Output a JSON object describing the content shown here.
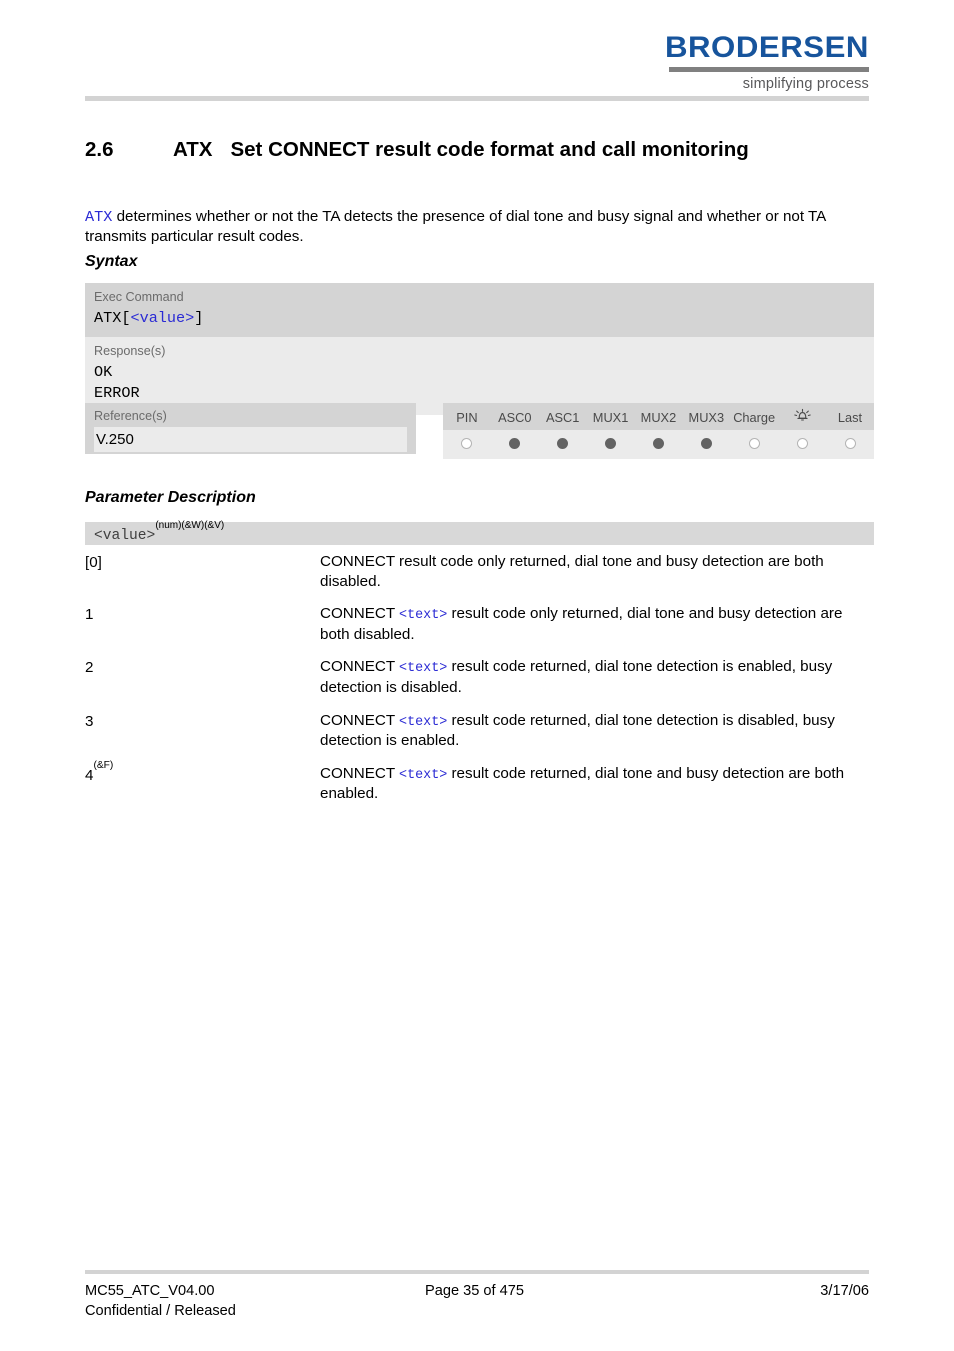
{
  "header": {
    "logo_wordmark": "BRODERSEN",
    "logo_tagline": "simplifying process"
  },
  "chapter": {
    "number": "2.6",
    "command": "ATX",
    "title": "Set CONNECT result code format and call monitoring"
  },
  "intro": {
    "command_code": "ATX",
    "text": " determines whether or not the TA detects the presence of dial tone and busy signal and whether or not TA transmits particular result codes."
  },
  "sections": {
    "syntax_heading": "Syntax",
    "parameter_heading": "Parameter Description"
  },
  "syntax": {
    "exec_label": "Exec Command",
    "exec_code_prefix": "ATX[",
    "exec_code_param": "<value>",
    "exec_code_suffix": "]",
    "response_label": "Response(s)",
    "response_ok": "OK",
    "response_error": "ERROR"
  },
  "reference": {
    "label": "Reference(s)",
    "value": "V.250"
  },
  "support": {
    "columns": [
      {
        "label": "PIN",
        "icon": null,
        "supported": false
      },
      {
        "label": "ASC0",
        "icon": null,
        "supported": true
      },
      {
        "label": "ASC1",
        "icon": null,
        "supported": true
      },
      {
        "label": "MUX1",
        "icon": null,
        "supported": true
      },
      {
        "label": "MUX2",
        "icon": null,
        "supported": true
      },
      {
        "label": "MUX3",
        "icon": null,
        "supported": true
      },
      {
        "label": "Charge",
        "icon": null,
        "supported": false
      },
      {
        "label": "",
        "icon": "alarm-icon",
        "supported": false
      },
      {
        "label": "Last",
        "icon": null,
        "supported": false
      }
    ]
  },
  "parameter": {
    "name": "<value>",
    "name_superscript": "(num)(&W)(&V)",
    "rows": [
      {
        "key": "[0]",
        "key_superscript": "",
        "desc_prefix": "CONNECT",
        "desc_code": "",
        "desc_suffix": " result code only returned, dial tone and busy detection are both disabled."
      },
      {
        "key": "1",
        "key_superscript": "",
        "desc_prefix": "CONNECT ",
        "desc_code": "<text>",
        "desc_suffix": " result code only returned, dial tone and busy detection are both disabled."
      },
      {
        "key": "2",
        "key_superscript": "",
        "desc_prefix": "CONNECT ",
        "desc_code": "<text>",
        "desc_suffix": " result code returned, dial tone detection is enabled, busy detection is disabled."
      },
      {
        "key": "3",
        "key_superscript": "",
        "desc_prefix": "CONNECT ",
        "desc_code": "<text>",
        "desc_suffix": " result code returned, dial tone detection is disabled, busy detection is enabled."
      },
      {
        "key": "4",
        "key_superscript": "(&F)",
        "desc_prefix": "CONNECT ",
        "desc_code": "<text>",
        "desc_suffix": " result code returned, dial tone and busy detection are both enabled."
      }
    ]
  },
  "footer": {
    "document_id": "MC55_ATC_V04.00",
    "classification": "Confidential / Released",
    "page": "Page 35 of 475",
    "date": "3/17/06"
  },
  "colors": {
    "brand_blue": "#17549c",
    "code_blue": "#2b2bd4",
    "box_dark": "#d4d4d4",
    "box_light": "#ebebeb",
    "rule_gray": "#d3d3d3",
    "dot_filled": "#636363"
  }
}
